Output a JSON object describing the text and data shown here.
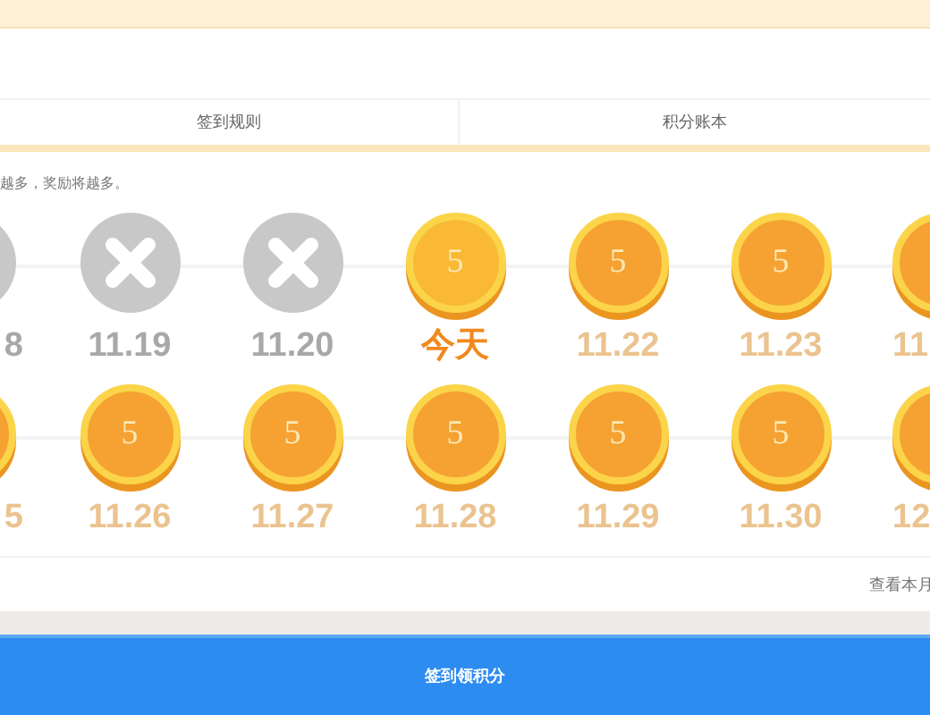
{
  "tabs": [
    {
      "label": "签到规则"
    },
    {
      "label": "积分账本"
    }
  ],
  "note": "越多，奖励将越多。",
  "calendar": [
    [
      {
        "label": "8",
        "kind": "missed",
        "today": false
      },
      {
        "label": "11.19",
        "kind": "missed",
        "today": false
      },
      {
        "label": "11.20",
        "kind": "missed",
        "today": false
      },
      {
        "label": "今天",
        "kind": "coin",
        "points": "5",
        "today": true
      },
      {
        "label": "11.22",
        "kind": "coin",
        "points": "5",
        "today": false
      },
      {
        "label": "11.23",
        "kind": "coin",
        "points": "5",
        "today": false
      },
      {
        "label": "11",
        "kind": "coin",
        "today": false
      }
    ],
    [
      {
        "label": "5",
        "kind": "coin",
        "today": false
      },
      {
        "label": "11.26",
        "kind": "coin",
        "points": "5",
        "today": false
      },
      {
        "label": "11.27",
        "kind": "coin",
        "points": "5",
        "today": false
      },
      {
        "label": "11.28",
        "kind": "coin",
        "points": "5",
        "today": false
      },
      {
        "label": "11.29",
        "kind": "coin",
        "points": "5",
        "today": false
      },
      {
        "label": "11.30",
        "kind": "coin",
        "points": "5",
        "today": false
      },
      {
        "label": "12",
        "kind": "coin",
        "today": false
      }
    ]
  ],
  "month_link": "查看本月",
  "sign_button": "签到领积分"
}
